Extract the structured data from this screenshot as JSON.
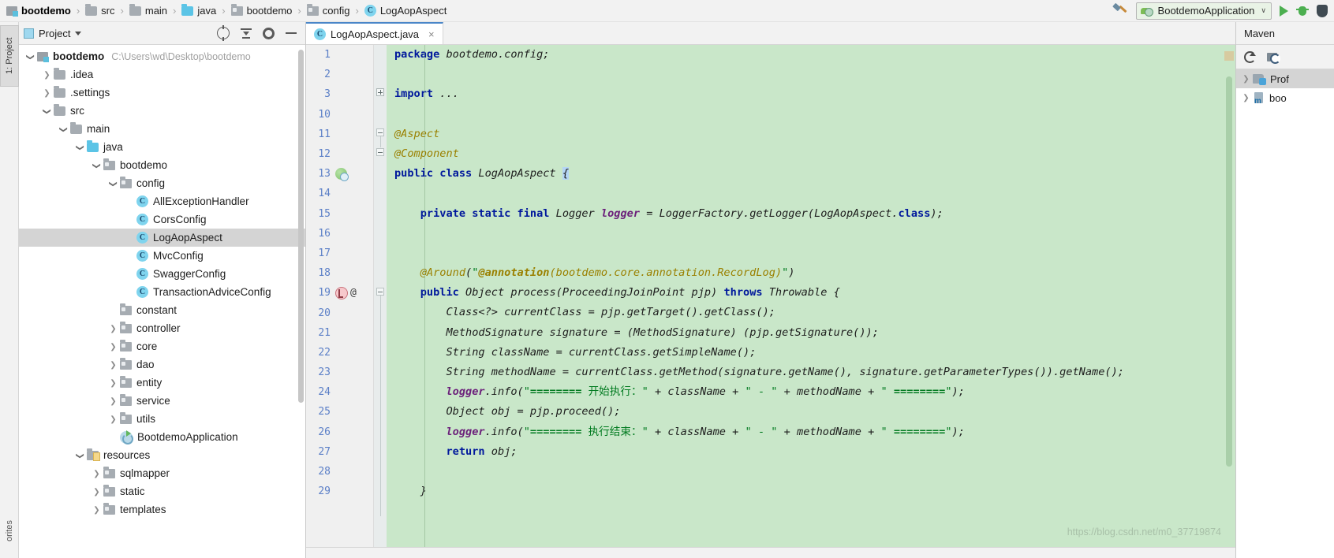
{
  "breadcrumb": {
    "items": [
      {
        "label": "bootdemo",
        "icon": "module-icon"
      },
      {
        "label": "src",
        "icon": "folder-icon"
      },
      {
        "label": "main",
        "icon": "folder-icon"
      },
      {
        "label": "java",
        "icon": "source-folder-icon"
      },
      {
        "label": "bootdemo",
        "icon": "package-icon"
      },
      {
        "label": "config",
        "icon": "package-icon"
      },
      {
        "label": "LogAopAspect",
        "icon": "class-icon"
      }
    ],
    "separator": "›"
  },
  "toolbar": {
    "build_icon": "hammer-icon",
    "run_config": "BootdemoApplication",
    "run_config_chevron": "∨",
    "run_icon": "run-play-icon",
    "debug_icon": "debug-bug-icon",
    "coverage_icon": "shield-icon"
  },
  "left_strip": {
    "project_tab": "1: Project",
    "favorites_tab": "orites"
  },
  "project_panel": {
    "title": "Project",
    "actions": [
      "locate-icon",
      "collapse-all-icon",
      "settings-gear-icon",
      "hide-icon"
    ],
    "tree": [
      {
        "depth": 0,
        "twisty": "down",
        "icon": "module-icon",
        "label": "bootdemo",
        "bold": true,
        "path": "C:\\Users\\wd\\Desktop\\bootdemo"
      },
      {
        "depth": 1,
        "twisty": "right",
        "icon": "folder-icon",
        "label": ".idea"
      },
      {
        "depth": 1,
        "twisty": "right",
        "icon": "folder-icon",
        "label": ".settings"
      },
      {
        "depth": 1,
        "twisty": "down",
        "icon": "folder-icon",
        "label": "src"
      },
      {
        "depth": 2,
        "twisty": "down",
        "icon": "folder-icon",
        "label": "main"
      },
      {
        "depth": 3,
        "twisty": "down",
        "icon": "source-folder-icon",
        "label": "java"
      },
      {
        "depth": 4,
        "twisty": "down",
        "icon": "package-icon",
        "label": "bootdemo"
      },
      {
        "depth": 5,
        "twisty": "down",
        "icon": "package-icon",
        "label": "config"
      },
      {
        "depth": 6,
        "twisty": "none",
        "icon": "class-icon",
        "label": "AllExceptionHandler"
      },
      {
        "depth": 6,
        "twisty": "none",
        "icon": "class-icon",
        "label": "CorsConfig"
      },
      {
        "depth": 6,
        "twisty": "none",
        "icon": "class-icon",
        "label": "LogAopAspect",
        "selected": true
      },
      {
        "depth": 6,
        "twisty": "none",
        "icon": "class-icon",
        "label": "MvcConfig"
      },
      {
        "depth": 6,
        "twisty": "none",
        "icon": "class-icon",
        "label": "SwaggerConfig"
      },
      {
        "depth": 6,
        "twisty": "none",
        "icon": "class-icon",
        "label": "TransactionAdviceConfig"
      },
      {
        "depth": 5,
        "twisty": "none",
        "icon": "package-icon",
        "label": "constant"
      },
      {
        "depth": 5,
        "twisty": "right",
        "icon": "package-icon",
        "label": "controller"
      },
      {
        "depth": 5,
        "twisty": "right",
        "icon": "package-icon",
        "label": "core"
      },
      {
        "depth": 5,
        "twisty": "right",
        "icon": "package-icon",
        "label": "dao"
      },
      {
        "depth": 5,
        "twisty": "right",
        "icon": "package-icon",
        "label": "entity"
      },
      {
        "depth": 5,
        "twisty": "right",
        "icon": "package-icon",
        "label": "service"
      },
      {
        "depth": 5,
        "twisty": "right",
        "icon": "package-icon",
        "label": "utils"
      },
      {
        "depth": 5,
        "twisty": "none",
        "icon": "springboot-icon",
        "label": "BootdemoApplication"
      },
      {
        "depth": 3,
        "twisty": "down",
        "icon": "resource-folder-icon",
        "label": "resources"
      },
      {
        "depth": 4,
        "twisty": "right",
        "icon": "package-icon",
        "label": "sqlmapper"
      },
      {
        "depth": 4,
        "twisty": "right",
        "icon": "package-icon",
        "label": "static"
      },
      {
        "depth": 4,
        "twisty": "right",
        "icon": "package-icon",
        "label": "templates"
      }
    ]
  },
  "editor": {
    "tab": {
      "label": "LogAopAspect.java",
      "icon": "class-icon",
      "close": "×"
    },
    "gutter_rows": [
      {
        "line": "1",
        "icons": []
      },
      {
        "line": "2",
        "icons": []
      },
      {
        "line": "3",
        "icons": []
      },
      {
        "line": "10",
        "icons": []
      },
      {
        "line": "11",
        "icons": []
      },
      {
        "line": "12",
        "icons": []
      },
      {
        "line": "13",
        "icons": [
          "spring-bean-icon"
        ]
      },
      {
        "line": "14",
        "icons": []
      },
      {
        "line": "15",
        "icons": []
      },
      {
        "line": "16",
        "icons": []
      },
      {
        "line": "17",
        "icons": []
      },
      {
        "line": "18",
        "icons": []
      },
      {
        "line": "19",
        "icons": [
          "aop-advice-icon",
          "annotation-at-icon"
        ]
      },
      {
        "line": "20",
        "icons": []
      },
      {
        "line": "21",
        "icons": []
      },
      {
        "line": "22",
        "icons": []
      },
      {
        "line": "23",
        "icons": []
      },
      {
        "line": "24",
        "icons": []
      },
      {
        "line": "25",
        "icons": []
      },
      {
        "line": "26",
        "icons": []
      },
      {
        "line": "27",
        "icons": []
      },
      {
        "line": "28",
        "icons": []
      },
      {
        "line": "29",
        "icons": []
      }
    ],
    "code_lines": [
      "package bootdemo.config;",
      "",
      "import ...",
      "",
      "@Aspect",
      "@Component",
      "public class LogAopAspect {",
      "",
      "    private static final Logger logger = LoggerFactory.getLogger(LogAopAspect.class);",
      "",
      "",
      "    @Around(\"@annotation(bootdemo.core.annotation.RecordLog)\")",
      "    public Object process(ProceedingJoinPoint pjp) throws Throwable {",
      "        Class<?> currentClass = pjp.getTarget().getClass();",
      "        MethodSignature signature = (MethodSignature) (pjp.getSignature());",
      "        String className = currentClass.getSimpleName();",
      "        String methodName = currentClass.getMethod(signature.getName(), signature.getParameterTypes()).getName();",
      "        logger.info(\"======== 开始执行：\" + className + \" - \" + methodName + \" ========\");",
      "        Object obj = pjp.proceed();",
      "        logger.info(\"======== 执行结束：\" + className + \" - \" + methodName + \" ========\");",
      "        return obj;",
      "",
      "    }"
    ],
    "watermark": "https://blog.csdn.net/m0_37719874",
    "background_color": "#c9e7c9"
  },
  "maven_panel": {
    "title": "Maven",
    "actions": [
      "refresh-icon",
      "add-maven-project-icon"
    ],
    "items": [
      {
        "label": "Prof",
        "icon": "profiles-icon",
        "selected": true
      },
      {
        "label": "boo",
        "icon": "maven-project-icon",
        "selected": false
      }
    ]
  }
}
